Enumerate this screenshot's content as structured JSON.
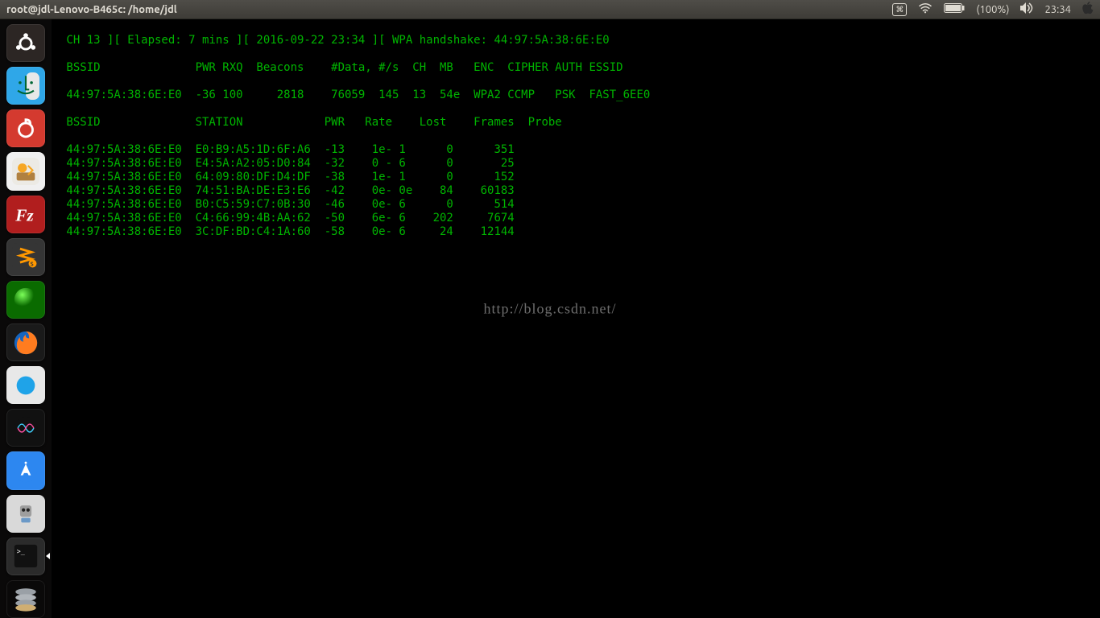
{
  "menubar": {
    "title": "root@jdl-Lenovo-B465c: /home/jdl",
    "battery_pct": "(100%)",
    "clock": "23:34"
  },
  "dock": {
    "items": [
      {
        "name": "ubuntu-dash",
        "bg": "#2c2624",
        "shape": "ubuntu"
      },
      {
        "name": "finder",
        "bg": "#2fa7e8",
        "shape": "finder"
      },
      {
        "name": "netease-music",
        "bg": "#d43a2f",
        "shape": "netease"
      },
      {
        "name": "software-updater",
        "bg": "#f0f0f0",
        "shape": "updater"
      },
      {
        "name": "filezilla",
        "bg": "#b11e1e",
        "shape": "filezilla"
      },
      {
        "name": "sublime-text",
        "bg": "#353535",
        "shape": "sublime"
      },
      {
        "name": "green-orb",
        "bg": "radial",
        "shape": "orb"
      },
      {
        "name": "firefox",
        "bg": "#1a1a1a",
        "shape": "firefox"
      },
      {
        "name": "safari",
        "bg": "#e8e8e8",
        "shape": "safari"
      },
      {
        "name": "siri",
        "bg": "#111",
        "shape": "siri"
      },
      {
        "name": "app-store",
        "bg": "#2d87f0",
        "shape": "appstore"
      },
      {
        "name": "automator",
        "bg": "#d9d9d9",
        "shape": "automator"
      },
      {
        "name": "terminal",
        "bg": "#2b2b2b",
        "shape": "terminal",
        "active": true
      },
      {
        "name": "disk-stack",
        "bg": "transparent",
        "shape": "disks"
      }
    ]
  },
  "terminal": {
    "status_line": " CH 13 ][ Elapsed: 7 mins ][ 2016-09-22 23:34 ][ WPA handshake: 44:97:5A:38:6E:E0",
    "ap_header": " BSSID              PWR RXQ  Beacons    #Data, #/s  CH  MB   ENC  CIPHER AUTH ESSID",
    "ap_row": " 44:97:5A:38:6E:E0  -36 100     2818    76059  145  13  54e  WPA2 CCMP   PSK  FAST_6EE0",
    "st_header": " BSSID              STATION            PWR   Rate    Lost    Frames  Probe",
    "stations": [
      " 44:97:5A:38:6E:E0  E0:B9:A5:1D:6F:A6  -13    1e- 1      0      351",
      " 44:97:5A:38:6E:E0  E4:5A:A2:05:D0:84  -32    0 - 6      0       25",
      " 44:97:5A:38:6E:E0  64:09:80:DF:D4:DF  -38    1e- 1      0      152",
      " 44:97:5A:38:6E:E0  74:51:BA:DE:E3:E6  -42    0e- 0e    84    60183",
      " 44:97:5A:38:6E:E0  B0:C5:59:C7:0B:30  -46    0e- 6      0      514",
      " 44:97:5A:38:6E:E0  C4:66:99:4B:AA:62  -50    6e- 6    202     7674",
      " 44:97:5A:38:6E:E0  3C:DF:BD:C4:1A:60  -58    0e- 6     24    12144"
    ]
  },
  "watermark": "http://blog.csdn.net/"
}
